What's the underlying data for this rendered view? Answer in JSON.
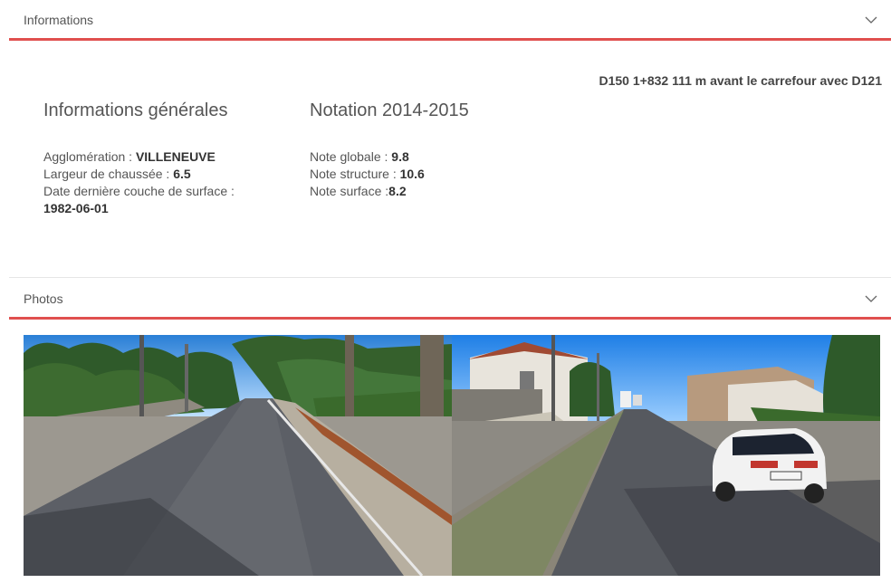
{
  "informations": {
    "header_title": "Informations",
    "location": "D150 1+832 111 m avant le carrefour avec D121",
    "general": {
      "title": "Informations générales",
      "agglomeration_label": "Agglomération : ",
      "agglomeration_value": "VILLENEUVE",
      "largeur_label": "Largeur de chaussée : ",
      "largeur_value": "6.5",
      "date_label": "Date dernière couche de surface :",
      "date_value": "1982-06-01"
    },
    "notation": {
      "title": "Notation 2014-2015",
      "globale_label": "Note globale : ",
      "globale_value": "9.8",
      "structure_label": "Note structure : ",
      "structure_value": "10.6",
      "surface_label": "Note surface :",
      "surface_value": "8.2"
    }
  },
  "photos": {
    "header_title": "Photos",
    "images": [
      "road-photo-left",
      "road-photo-right"
    ]
  },
  "icons": {
    "collapse": "chevron-down-icon"
  },
  "colors": {
    "accent": "#e0504f",
    "sky": "#2f8fe0",
    "road": "#5c5f66"
  }
}
